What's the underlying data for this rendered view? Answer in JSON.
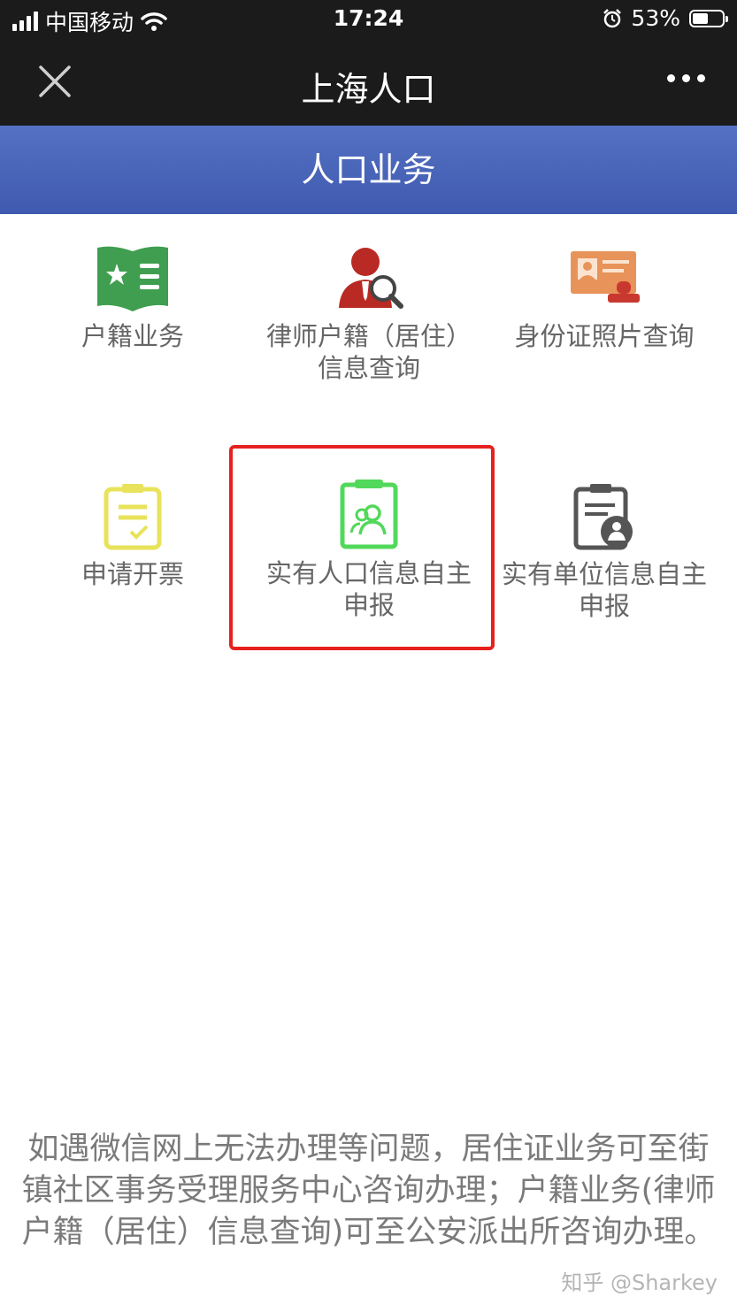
{
  "status_bar": {
    "carrier": "中国移动",
    "time": "17:24",
    "battery": "53%",
    "battery_level": 0.53
  },
  "nav": {
    "title": "上海人口",
    "close_icon": "close-icon",
    "more_icon": "more-icon"
  },
  "section": {
    "title": "人口业务"
  },
  "services": [
    {
      "label": "户籍业务",
      "icon": "household-book-icon",
      "color": "#3f9e4f"
    },
    {
      "label": "律师户籍（居住）\n信息查询",
      "icon": "lawyer-search-icon",
      "color": "#b92a24"
    },
    {
      "label": "身份证照片查询",
      "icon": "id-card-photo-icon",
      "color": "#e8935a"
    },
    {
      "label": "申请开票",
      "icon": "invoice-clipboard-icon",
      "color": "#e8e35a"
    },
    {
      "label": "实有人口信息自主\n申报",
      "icon": "population-clipboard-icon",
      "color": "#52d85a"
    },
    {
      "label": "实有单位信息自主\n申报",
      "icon": "unit-clipboard-icon",
      "color": "#555555"
    }
  ],
  "footer": {
    "note": "如遇微信网上无法办理等问题，居住证业务可至街镇社区事务受理服务中心咨询办理；户籍业务(律师户籍（居住）信息查询)可至公安派出所咨询办理。"
  },
  "watermark": "知乎 @Sharkey",
  "colors": {
    "header_blue": "#4a65b9",
    "highlight_red": "#e6211d",
    "bar_dark": "#1b1b1b"
  }
}
